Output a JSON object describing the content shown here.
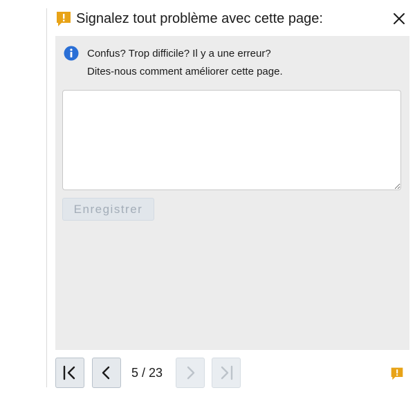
{
  "header": {
    "title": "Signalez tout problème avec cette page:",
    "flag_icon": "report-flag-icon",
    "close_icon": "close-icon"
  },
  "info": {
    "line1": "Confus? Trop difficile? Il y a une erreur?",
    "line2": "Dites-nous comment améliorer cette page.",
    "icon": "info-icon"
  },
  "feedback": {
    "value": "",
    "placeholder": ""
  },
  "save_label": "Enregistrer",
  "pagination": {
    "current": 5,
    "total": 23,
    "label": "5 / 23"
  },
  "colors": {
    "accent_orange": "#e8a317",
    "info_blue": "#2a6fd6",
    "panel_bg": "#ececec"
  }
}
